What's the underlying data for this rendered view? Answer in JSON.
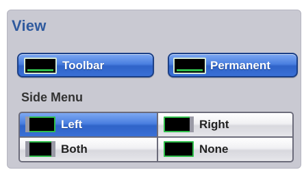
{
  "view": {
    "title": "View",
    "buttons": [
      {
        "label": "Toolbar",
        "icon": "monitor-icon",
        "active": true
      },
      {
        "label": "Permanent",
        "icon": "monitor-icon",
        "active": true
      }
    ]
  },
  "side_menu": {
    "title": "Side Menu",
    "selected": "Left",
    "options": [
      {
        "label": "Left",
        "icon": "side-left-screen-icon",
        "active": true
      },
      {
        "label": "Right",
        "icon": "side-right-screen-icon",
        "active": false
      },
      {
        "label": "Both",
        "icon": "side-both-screen-icon",
        "active": false
      },
      {
        "label": "None",
        "icon": "no-side-screen-icon",
        "active": false
      }
    ]
  },
  "colors": {
    "accent_blue": "#3a70d6",
    "title_blue": "#2f5a9e",
    "panel_bg": "#c9c9d2",
    "icon_green": "#2fbf4a"
  }
}
